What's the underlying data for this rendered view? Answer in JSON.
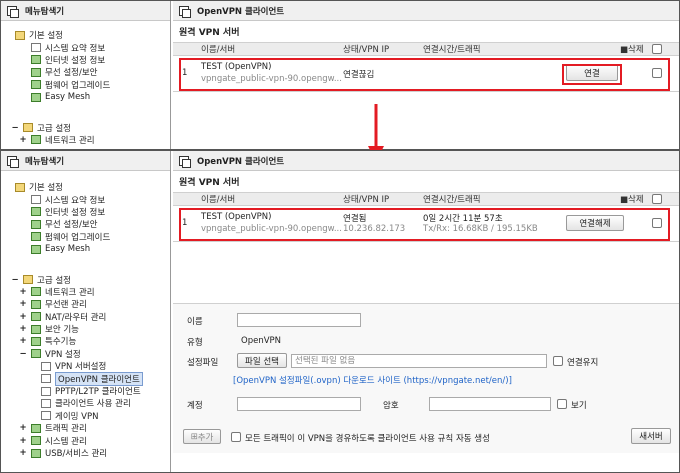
{
  "sidebar": {
    "title": "메뉴탐색기",
    "basic_label": "기본 설정",
    "basic_items": [
      "시스템 요약 정보",
      "인터넷 설정 정보",
      "무선 설정/보안",
      "펌웨어 업그레이드",
      "Easy Mesh"
    ],
    "advanced_label": "고급 설정",
    "advanced_items": [
      "네트워크 관리",
      "무선랜 관리",
      "NAT/라우터 관리",
      "보안 기능",
      "특수기능",
      "VPN 설정"
    ],
    "vpn_items": [
      "VPN 서버설정",
      "OpenVPN 클라이언트",
      "PPTP/L2TP 클라이언트",
      "클라이언트 사용 관리",
      "게이밍 VPN"
    ],
    "tail_items": [
      "트래픽 관리",
      "시스템 관리",
      "USB/서비스 관리"
    ]
  },
  "panel": {
    "title": "OpenVPN 클라이언트",
    "section": "원격 VPN 서버",
    "columns": {
      "name": "이름/서버",
      "status": "상태/VPN IP",
      "time": "연결시간/트래픽",
      "delete": "삭제"
    },
    "delete_prefix": "■"
  },
  "before": {
    "index": "1",
    "name": "TEST (OpenVPN)",
    "server": "vpngate_public-vpn-90.opengw...",
    "status": "연결끊김",
    "button": "연결"
  },
  "after": {
    "index": "1",
    "name": "TEST (OpenVPN)",
    "server": "vpngate_public-vpn-90.opengw...",
    "status": "연결됨",
    "vpn_ip": "10.236.82.173",
    "time": "0일 2시간 11분 57초",
    "traffic": "Tx/Rx: 16.68KB / 195.15KB",
    "button": "연결해제"
  },
  "form": {
    "name_label": "이름",
    "type_label": "유형",
    "type_value": "OpenVPN",
    "config_label": "설정파일",
    "file_button": "파일 선택",
    "file_placeholder": "선택된 파일 없음",
    "keep_label": "연결유지",
    "download_link": "[OpenVPN 설정파일(.ovpn) 다운로드 사이트 (https://vpngate.net/en/)]",
    "account_label": "계정",
    "password_label": "암호",
    "show_label": "보기",
    "add_button": "추가",
    "add_prefix": "⊞",
    "policy_label": "모든 트래픽이 이 VPN을 경유하도록 클라이언트 사용 규칙 자동 생성",
    "new_server_button": "새서버"
  },
  "colors": {
    "highlight": "#e31b23",
    "link": "#1f63c7"
  }
}
